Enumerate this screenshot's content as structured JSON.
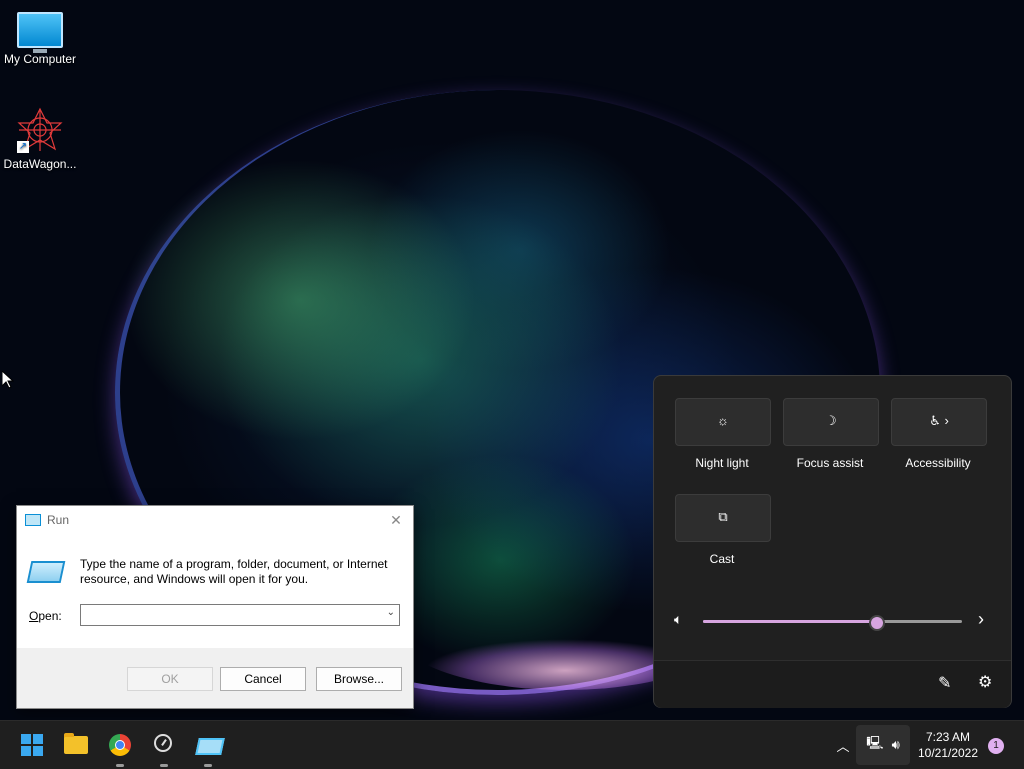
{
  "desktop": {
    "icons": [
      {
        "label": "My Computer",
        "icon": "computer-icon"
      },
      {
        "label": "DataWagon...",
        "icon": "datawagon-icon"
      }
    ]
  },
  "run_dialog": {
    "title": "Run",
    "description": "Type the name of a program, folder, document, or Internet resource, and Windows will open it for you.",
    "open_label": "Open:",
    "open_value": "",
    "ok_label": "OK",
    "cancel_label": "Cancel",
    "browse_label": "Browse..."
  },
  "quick_settings": {
    "tiles": [
      {
        "label": "Night light",
        "icon": "brightness-icon",
        "glyph": "☼"
      },
      {
        "label": "Focus assist",
        "icon": "moon-icon",
        "glyph": "☽"
      },
      {
        "label": "Accessibility",
        "icon": "accessibility-icon",
        "glyph": "♿ ›"
      },
      {
        "label": "Cast",
        "icon": "cast-icon",
        "glyph": "⧉"
      }
    ],
    "volume": {
      "level": 0.67,
      "accent": "#d7a5e0"
    }
  },
  "taskbar": {
    "apps": [
      "start",
      "file-explorer",
      "chrome",
      "speed-monitor",
      "run-app"
    ],
    "clock_time": "7:23 AM",
    "clock_date": "10/21/2022",
    "notification_count": "1"
  }
}
